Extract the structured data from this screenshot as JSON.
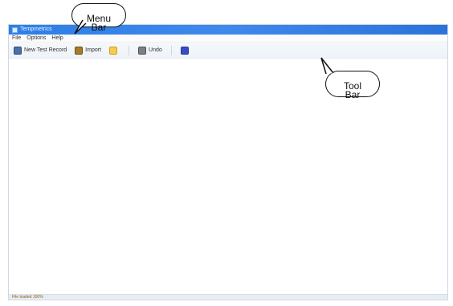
{
  "window": {
    "title": "Tempmetrics"
  },
  "menubar": {
    "items": [
      "File",
      "Options",
      "Help"
    ]
  },
  "toolbar": {
    "items": [
      {
        "label": "New Test Record",
        "icon": "new-test-icon"
      },
      {
        "label": "Import",
        "icon": "import-icon"
      },
      {
        "label": "",
        "icon": "yellow-tool-icon"
      },
      {
        "label": "Undo",
        "icon": "undo-icon"
      },
      {
        "label": "",
        "icon": "blue-tool-icon"
      }
    ]
  },
  "status": {
    "text": "File loaded 100%"
  },
  "callouts": {
    "menu": "Menu\nBar",
    "tool": "Tool\nBar"
  }
}
